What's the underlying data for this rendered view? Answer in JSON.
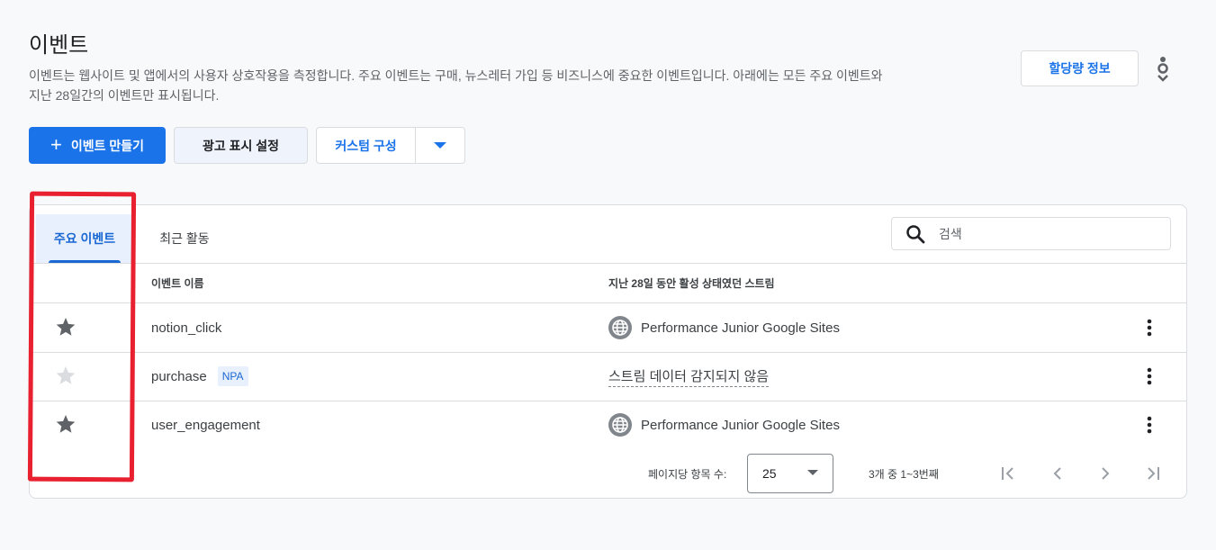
{
  "header": {
    "title": "이벤트",
    "description_line1": "이벤트는 웹사이트 및 앱에서의 사용자 상호작용을 측정합니다. 주요 이벤트는 구매, 뉴스레터 가입 등 비즈니스에 중요한 이벤트입니다. 아래에는 모든 주요 이벤트와",
    "description_line2": "지난 28일간의 이벤트만 표시됩니다.",
    "quota_button": "할당량 정보"
  },
  "toolbar": {
    "create_button": "이벤트 만들기",
    "create_icon": "+",
    "ad_settings_button": "광고 표시 설정",
    "custom_config_button": "커스텀 구성"
  },
  "tabs": [
    {
      "label": "주요 이벤트",
      "active": true
    },
    {
      "label": "최근 활동",
      "active": false
    }
  ],
  "search": {
    "placeholder": "검색"
  },
  "table": {
    "columns": [
      "이벤트 이름",
      "지난 28일 동안 활성 상태였던 스트림"
    ],
    "rows": [
      {
        "starred": true,
        "name": "notion_click",
        "badge": "",
        "stream": "Performance Junior Google Sites",
        "stream_icon": "globe-icon"
      },
      {
        "starred": false,
        "name": "purchase",
        "badge": "NPA",
        "stream": "스트림 데이터 감지되지 않음",
        "stream_icon": ""
      },
      {
        "starred": true,
        "name": "user_engagement",
        "badge": "",
        "stream": "Performance Junior Google Sites",
        "stream_icon": "globe-icon"
      }
    ]
  },
  "pagination": {
    "per_page_label": "페이지당 항목 수:",
    "per_page_value": "25",
    "range_text": "3개 중 1~3번째"
  },
  "colors": {
    "primary": "#1a73e8",
    "annotation": "#e8202f",
    "star_active": "#5f6368",
    "star_inactive": "#dadce0"
  }
}
